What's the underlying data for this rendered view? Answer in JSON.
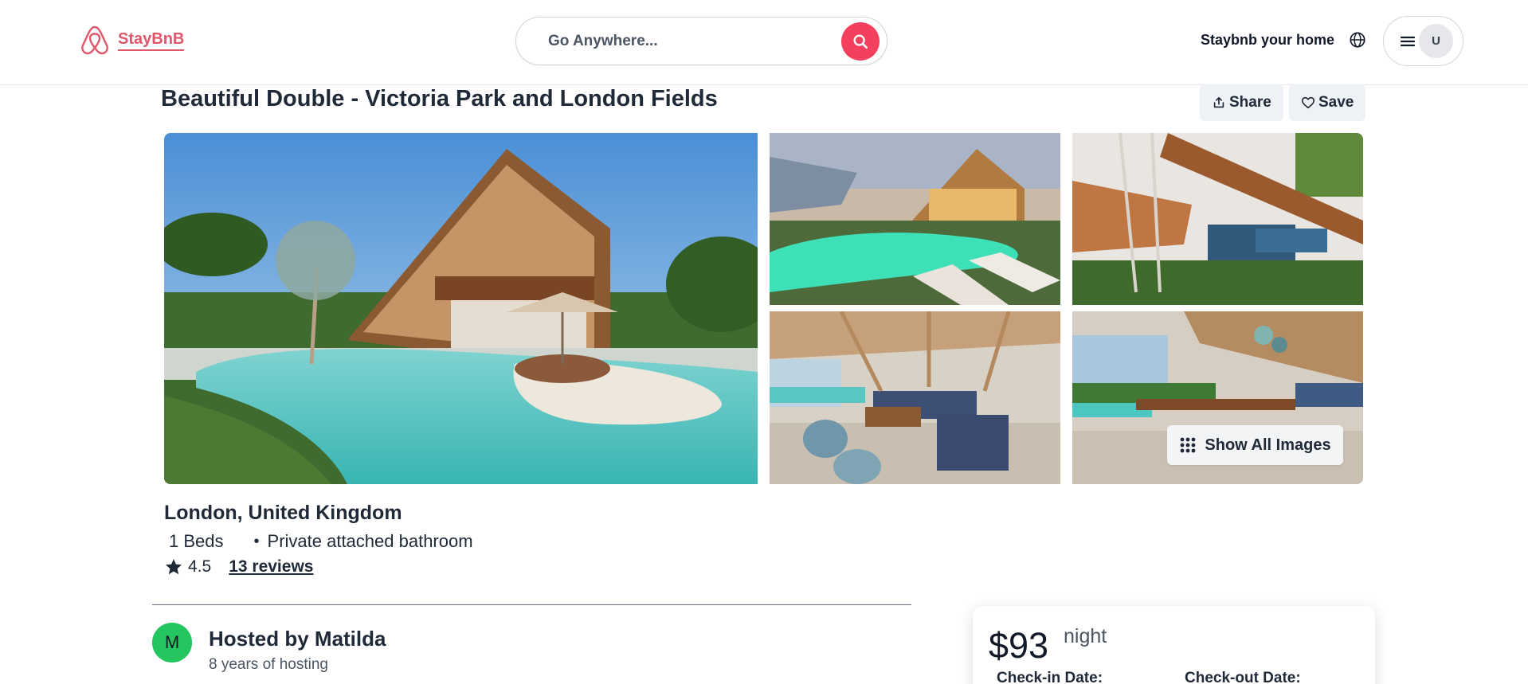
{
  "navbar": {
    "logo_text": "StayBnB",
    "search": {
      "placeholder": "Go Anywhere..."
    },
    "host_link": "Staybnb your home",
    "avatar_initial": "U"
  },
  "listing": {
    "title": "Beautiful Double - Victoria Park and London Fields",
    "share_label": "Share",
    "save_label": "Save",
    "show_all_label": "Show All Images",
    "location": "London, United Kingdom",
    "beds": "1 Beds",
    "amenity": "Private attached bathroom",
    "rating": "4.5",
    "reviews": "13 reviews"
  },
  "host": {
    "initial": "M",
    "name": "Hosted by Matilda",
    "years": "8 years of hosting"
  },
  "booking": {
    "price": "$93",
    "unit": "night",
    "checkin_label": "Check-in Date:",
    "checkout_label": "Check-out Date:"
  },
  "colors": {
    "brand": "#e0566a",
    "search_button": "#f43f5e",
    "host_avatar": "#22c55e"
  }
}
